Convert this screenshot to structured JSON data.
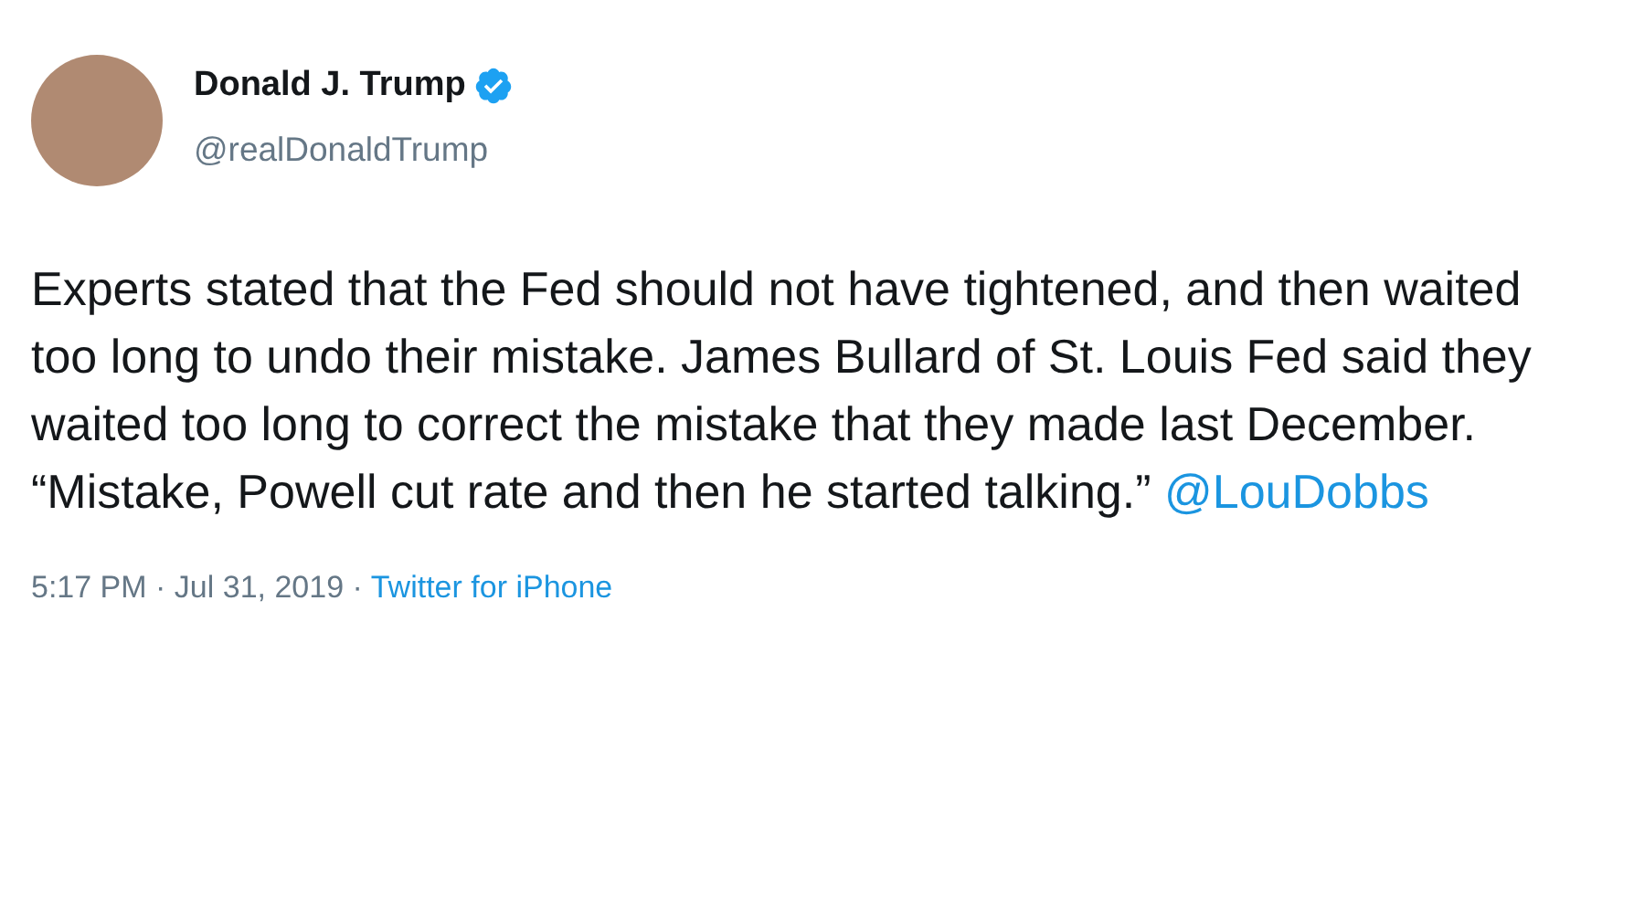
{
  "author": {
    "name": "Donald J. Trump",
    "verified": true,
    "handle": "@realDonaldTrump"
  },
  "tweet": {
    "text": "Experts stated that the Fed should not have tightened, and then waited too long to undo their mistake. James Bullard of St. Louis Fed said they waited too long to correct the mistake that they made last December. “Mistake, Powell cut rate and then he started talking.”",
    "mention": "@LouDobbs"
  },
  "meta": {
    "timestamp": "5:17 PM · Jul 31, 2019 · ",
    "source": "Twitter for iPhone"
  }
}
